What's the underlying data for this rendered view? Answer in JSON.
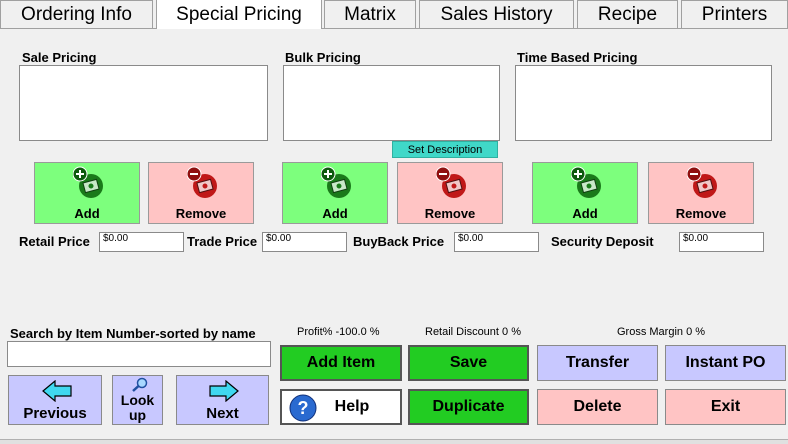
{
  "tabs": [
    {
      "label": "Ordering Info",
      "active": false
    },
    {
      "label": "Special Pricing",
      "active": true
    },
    {
      "label": "Matrix",
      "active": false
    },
    {
      "label": "Sales History",
      "active": false
    },
    {
      "label": "Recipe",
      "active": false
    },
    {
      "label": "Printers",
      "active": false
    }
  ],
  "sections": {
    "sale": "Sale Pricing",
    "bulk": "Bulk Pricing",
    "time": "Time Based Pricing"
  },
  "set_description": "Set Description",
  "buttons": {
    "add": "Add",
    "remove": "Remove"
  },
  "prices": {
    "retail_label": "Retail Price",
    "retail_value": "$0.00",
    "trade_label": "Trade Price",
    "trade_value": "$0.00",
    "buyback_label": "BuyBack Price",
    "buyback_value": "$0.00",
    "security_label": "Security Deposit",
    "security_value": "$0.00"
  },
  "search": {
    "label": "Search by Item Number-sorted by name",
    "value": ""
  },
  "stats": {
    "profit": "Profit%   -100.0 %",
    "retail_discount": "Retail Discount   0 %",
    "gross_margin": "Gross Margin   0 %"
  },
  "nav": {
    "previous": "Previous",
    "lookup_1": "Look",
    "lookup_2": "up",
    "next": "Next"
  },
  "actions": {
    "add_item": "Add Item",
    "save": "Save",
    "transfer": "Transfer",
    "instant_po": "Instant PO",
    "help": "Help",
    "duplicate": "Duplicate",
    "delete": "Delete",
    "exit": "Exit"
  },
  "colors": {
    "add_bg": "#7dff7d",
    "remove_bg": "#ffc4c4",
    "action_green": "#22cc22",
    "action_purple": "#c8c8ff",
    "set_desc_bg": "#40d8c8"
  }
}
